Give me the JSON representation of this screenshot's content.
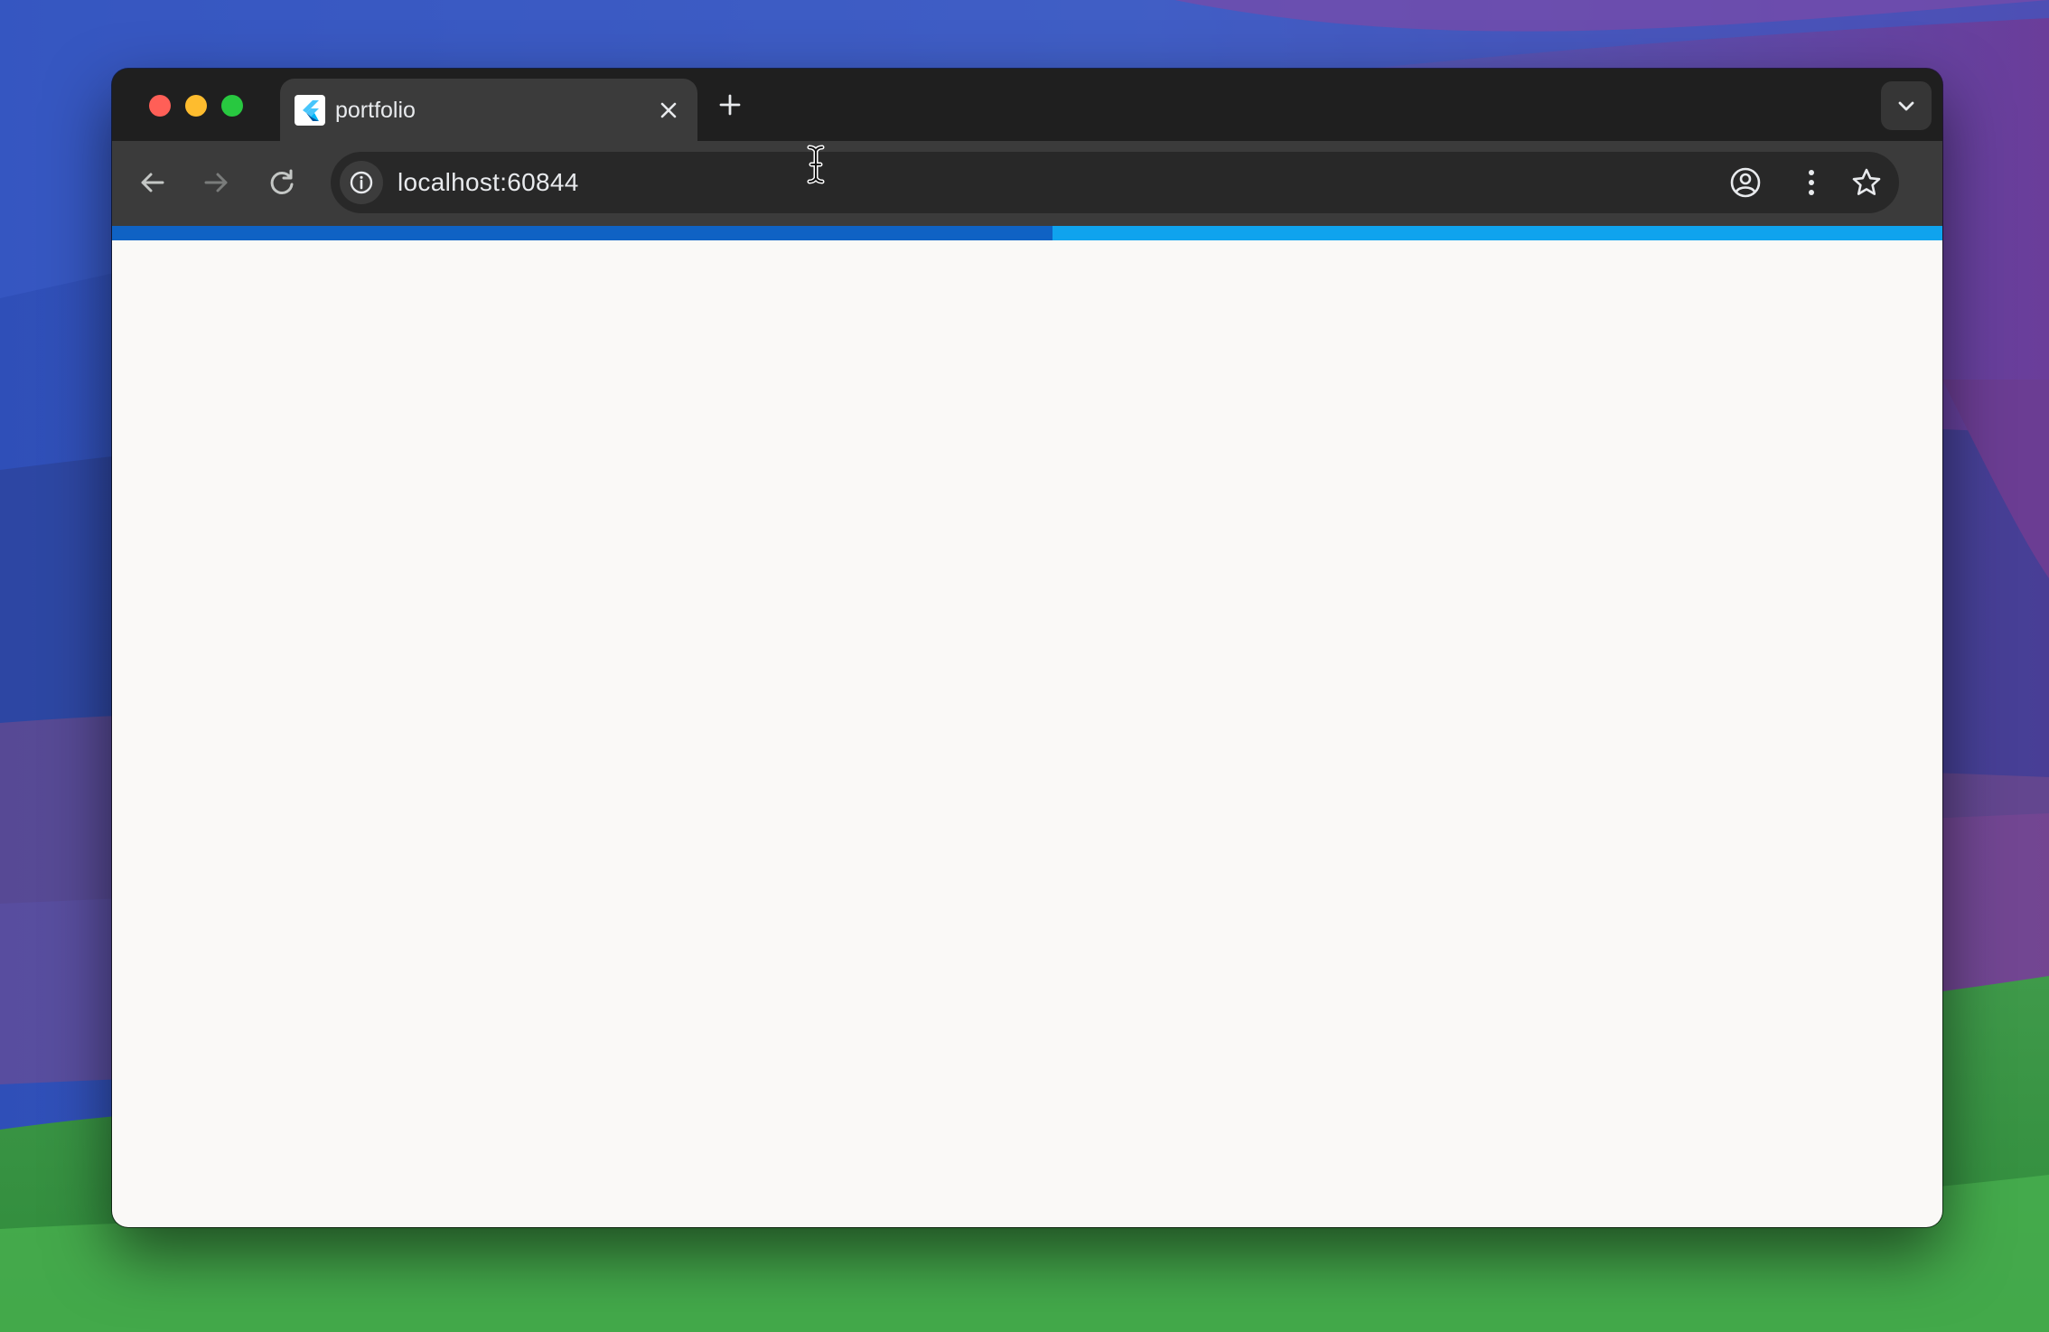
{
  "browser": {
    "tab": {
      "title": "portfolio",
      "favicon": "flutter-logo-icon"
    },
    "tab_strip": {
      "new_tab_icon": "plus-icon",
      "tab_search_icon": "chevron-down-icon"
    },
    "toolbar": {
      "back_icon": "arrow-left-icon",
      "forward_icon": "arrow-right-icon",
      "reload_icon": "reload-icon",
      "site_info_icon": "info-icon",
      "bookmark_icon": "star-icon",
      "profile_icon": "profile-icon",
      "menu_icon": "three-dots-vertical-icon"
    },
    "address_bar": {
      "url": "localhost:60844"
    },
    "loading": {
      "progress_fraction": 0.514
    }
  },
  "colors": {
    "tab_strip": "#1f1f1f",
    "toolbar": "#3b3b3b",
    "omnibox": "#282828",
    "progress_track": "#0f62c4",
    "progress_fill": "#0fa3ee",
    "page_background": "#faf9f7",
    "traffic_close": "#ff5f57",
    "traffic_minimize": "#febc2e",
    "traffic_maximize": "#28c840"
  }
}
